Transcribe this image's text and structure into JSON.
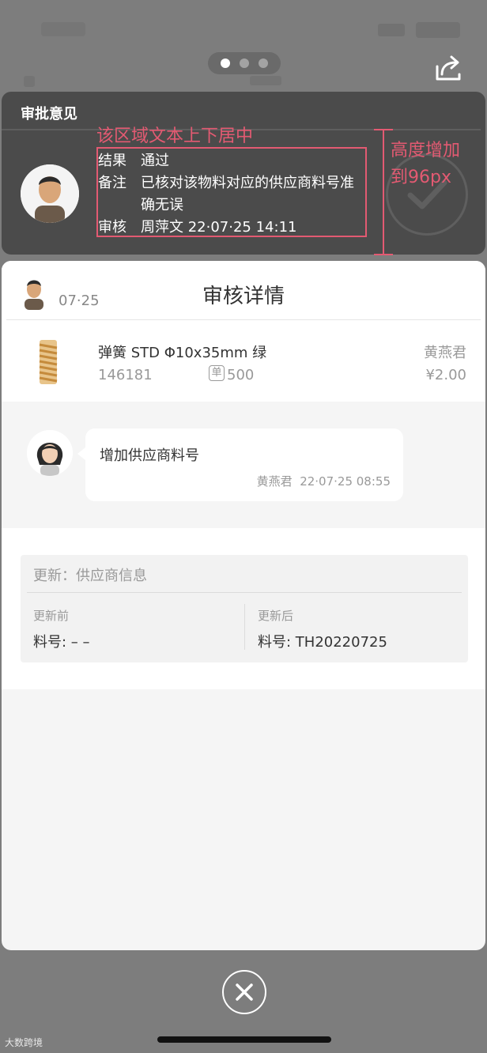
{
  "pager": {
    "count": 3,
    "active": 0
  },
  "approval": {
    "title": "审批意见",
    "rows": [
      {
        "key": "结果",
        "value": "通过"
      },
      {
        "key": "备注",
        "value": "已核对该物料对应的供应商料号准确无误"
      },
      {
        "key": "审核",
        "value": "周萍文  22·07·25  14:11"
      }
    ]
  },
  "annotations": {
    "center_note": "该区域文本上下居中",
    "height_note": "高度增加到96px"
  },
  "detail": {
    "header_date": "07·25",
    "title": "审核详情",
    "item": {
      "name": "弹簧 STD Φ10x35mm 绿",
      "code": "146181",
      "unit_icon": "单",
      "qty": "500",
      "owner": "黄燕君",
      "price": "¥2.00"
    },
    "comment": {
      "text": "增加供应商料号",
      "author": "黄燕君",
      "time": "22·07·25 08:55"
    },
    "update": {
      "title": "更新：供应商信息",
      "before_label": "更新前",
      "before_value": "料号: – –",
      "after_label": "更新后",
      "after_value": "料号: TH20220725"
    }
  },
  "icons": {
    "share": "share-icon",
    "close": "close-icon",
    "stamp": "check-stamp-icon",
    "spring": "spring-icon"
  },
  "watermark": "大数跨境",
  "colors": {
    "annotation": "#e35a72",
    "overlay": "#7d7d7d",
    "card_dark": "#4b4b4b"
  }
}
